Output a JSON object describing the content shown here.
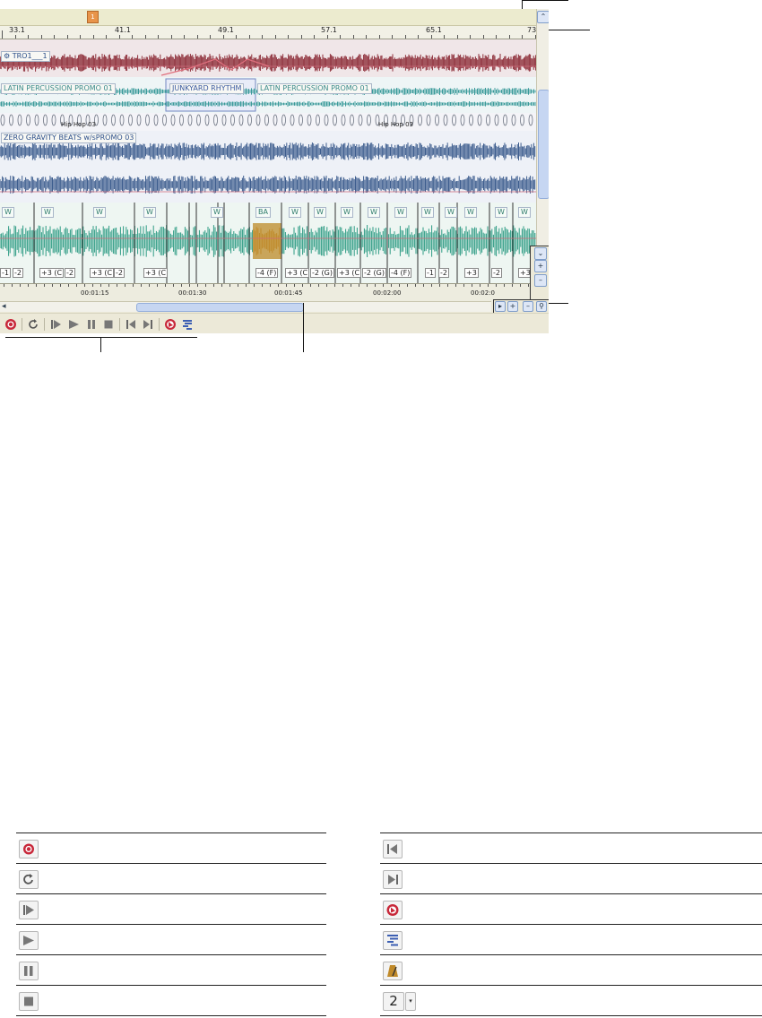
{
  "ruler": {
    "labels": [
      "33.1",
      "41.1",
      "49.1",
      "57.1",
      "65.1",
      "73"
    ]
  },
  "marker": {
    "label": "1"
  },
  "tracks": {
    "track1_clip": "TRO1___1",
    "track2_clips": [
      "LATIN PERCUSSION PROMO 01",
      "JUNKYARD RHYTHM",
      "LATIN PERCUSSION PROMO 01"
    ],
    "track3_labels": [
      "Hip Hop 03",
      "Hip Hop 03"
    ],
    "track4_clip": "ZERO GRAVITY BEATS w/sPROMO 03",
    "track5_clips": [
      "W",
      "W",
      "W",
      "W",
      "W",
      "BA",
      "W",
      "W",
      "W",
      "W",
      "W",
      "W",
      "W",
      "W",
      "W",
      "W"
    ],
    "pitch_labels": [
      "-1",
      "-2",
      "+3 (C",
      "-2",
      "+3 (C",
      "-2",
      "+3 (C",
      "-4 (F)",
      "+3 (C",
      "-2 (G)",
      "+3 (C",
      "-2 (G)",
      "-4 (F)",
      "-1",
      "-2",
      "+3",
      "-2",
      "+3 (C",
      "-2",
      "+3"
    ]
  },
  "timebar": {
    "labels": [
      "00:01:15",
      "00:01:30",
      "00:01:45",
      "00:02:00",
      "00:02:0"
    ]
  },
  "zoom": {
    "buttons": [
      "+",
      "-",
      "+",
      "-",
      "magnify"
    ]
  },
  "transport": {
    "icons": [
      "record-icon",
      "loop-icon",
      "play-from-start-icon",
      "play-icon",
      "pause-icon",
      "stop-icon",
      "go-to-start-icon",
      "go-to-end-icon",
      "record-punch-icon",
      "metronome-settings-icon"
    ]
  },
  "legend": {
    "left_icons": [
      "record-icon",
      "loop-icon",
      "play-from-start-icon",
      "play-icon",
      "pause-icon",
      "stop-icon"
    ],
    "right_icons": [
      "go-to-start-icon",
      "go-to-end-icon",
      "record-punch-icon",
      "mixer-icon",
      "metronome-icon",
      "count-in-dropdown-icon"
    ],
    "count_in_value": "2"
  },
  "colors": {
    "track_red": "#8e2f3a",
    "track_teal": "#3a9a9a",
    "track_blue": "#3d5d8e",
    "track_green": "#2e9c84",
    "track_orange": "#c08a2a",
    "record_red": "#c8283a"
  }
}
